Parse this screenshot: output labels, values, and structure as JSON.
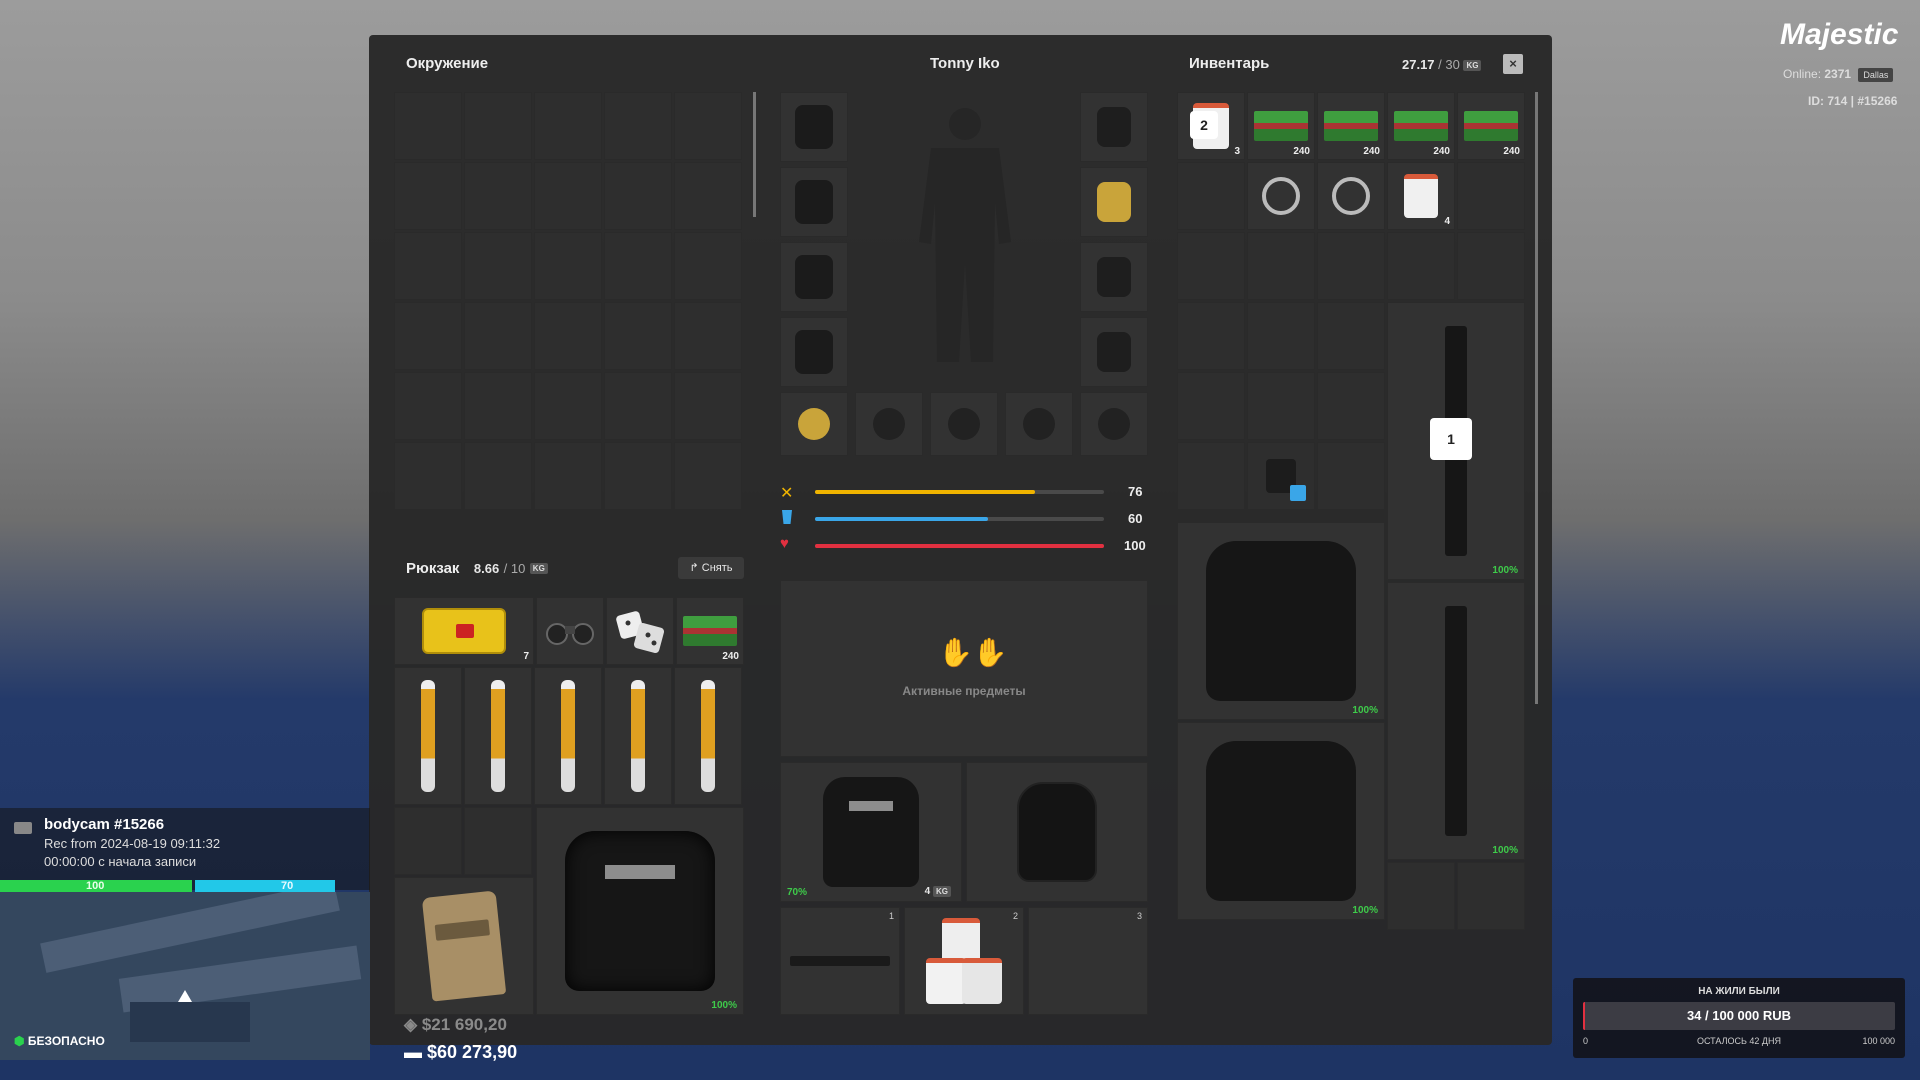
{
  "brand": {
    "logo": "Majestic",
    "online_label": "Online:",
    "online_count": "2371",
    "server": "Dallas",
    "id_line": "ID: 714 | #15266"
  },
  "surroundings": {
    "title": "Окружение"
  },
  "character": {
    "name": "Tonny Iko"
  },
  "inventory": {
    "title": "Инвентарь",
    "weight_current": "27.17",
    "weight_sep": "/ 30",
    "weight_unit": "KG",
    "top_row_qty": [
      "3",
      "240",
      "240",
      "240",
      "240"
    ],
    "top_slot_badge": "2",
    "paper_qty": "4",
    "weapon_badge": "1",
    "weapon1_pct": "100%",
    "weapon2_pct": "100%",
    "vest1_pct": "100%",
    "vest2_pct": "100%"
  },
  "backpack": {
    "title": "Рюкзак",
    "weight": "8.66",
    "weight_max": "/ 10",
    "weight_unit": "KG",
    "remove_label": "Снять",
    "medkit_qty": "7",
    "ammo_qty": "240",
    "vest_pct": "100%"
  },
  "stats": {
    "hunger": {
      "value": 76,
      "color": "#f0b400"
    },
    "thirst": {
      "value": 60,
      "color": "#3aa6e8"
    },
    "health": {
      "value": 100,
      "color": "#e23040"
    }
  },
  "active_items": {
    "label": "Активные предметы"
  },
  "equipped": {
    "vest_pct": "70%",
    "vest_weight": "4",
    "vest_unit": "KG",
    "slot_numbers": [
      "1",
      "2",
      "3"
    ]
  },
  "money": {
    "bank": "$21 690,20",
    "cash": "$60 273,90"
  },
  "bodycam": {
    "title": "bodycam #15266",
    "rec_line": "Rec from 2024-08-19 09:11:32",
    "time_line": "00:00:00 с начала записи"
  },
  "hud": {
    "health": 100,
    "armor": 70,
    "zone": "БЕЗОПАСНО"
  },
  "goal": {
    "title": "НА ЖИЛИ БЫЛИ",
    "progress_text": "34 / 100 000 RUB",
    "min": "0",
    "remaining": "ОСТАЛОСЬ 42 ДНЯ",
    "max": "100 000",
    "current": 34,
    "target": 100000
  }
}
